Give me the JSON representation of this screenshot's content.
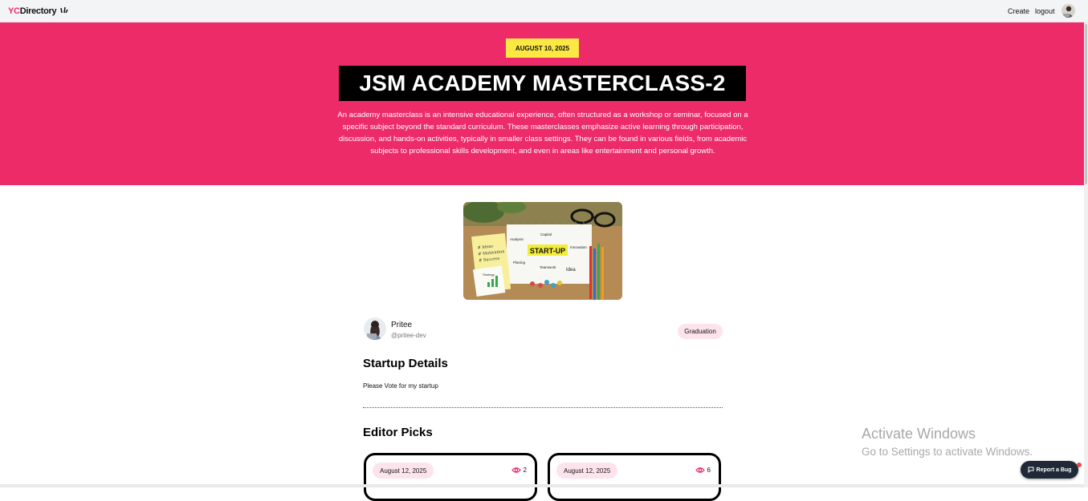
{
  "nav": {
    "logo_yc": "YC",
    "logo_rest": "Directory",
    "create_label": "Create",
    "logout_label": "logout"
  },
  "hero": {
    "date": "AUGUST 10, 2025",
    "title": "JSM ACADEMY MASTERCLASS-2",
    "description": "An academy masterclass is an intensive educational experience, often structured as a workshop or seminar, focused on a specific subject beyond the standard curriculum. These masterclasses emphasize active learning through participation, discussion, and hands-on activities, typically in smaller class settings. They can be found in various fields, from academic subjects to professional skills development, and even in areas like entertainment and personal growth."
  },
  "image": {
    "center_label": "START-UP",
    "note_lines": [
      "# Ideas",
      "# Motivation",
      "# Success"
    ],
    "words": [
      "Analysis",
      "Capital",
      "Planing",
      "Teamwork",
      "Innovation",
      "Idea",
      "Strategy"
    ]
  },
  "author": {
    "name": "Pritee",
    "handle": "@pritee-dev"
  },
  "category": "Graduation",
  "details": {
    "title": "Startup Details",
    "pitch": "Please Vote for my startup"
  },
  "editor": {
    "title": "Editor Picks",
    "cards": [
      {
        "date": "August 12, 2025",
        "views": "2"
      },
      {
        "date": "August 12, 2025",
        "views": "6"
      }
    ]
  },
  "watermark": {
    "title": "Activate Windows",
    "subtitle": "Go to Settings to activate Windows."
  },
  "report_bug": "Report a Bug",
  "colors": {
    "primary": "#ee2b69",
    "secondary": "#fbe843",
    "badge_bg": "#fde4ec"
  }
}
